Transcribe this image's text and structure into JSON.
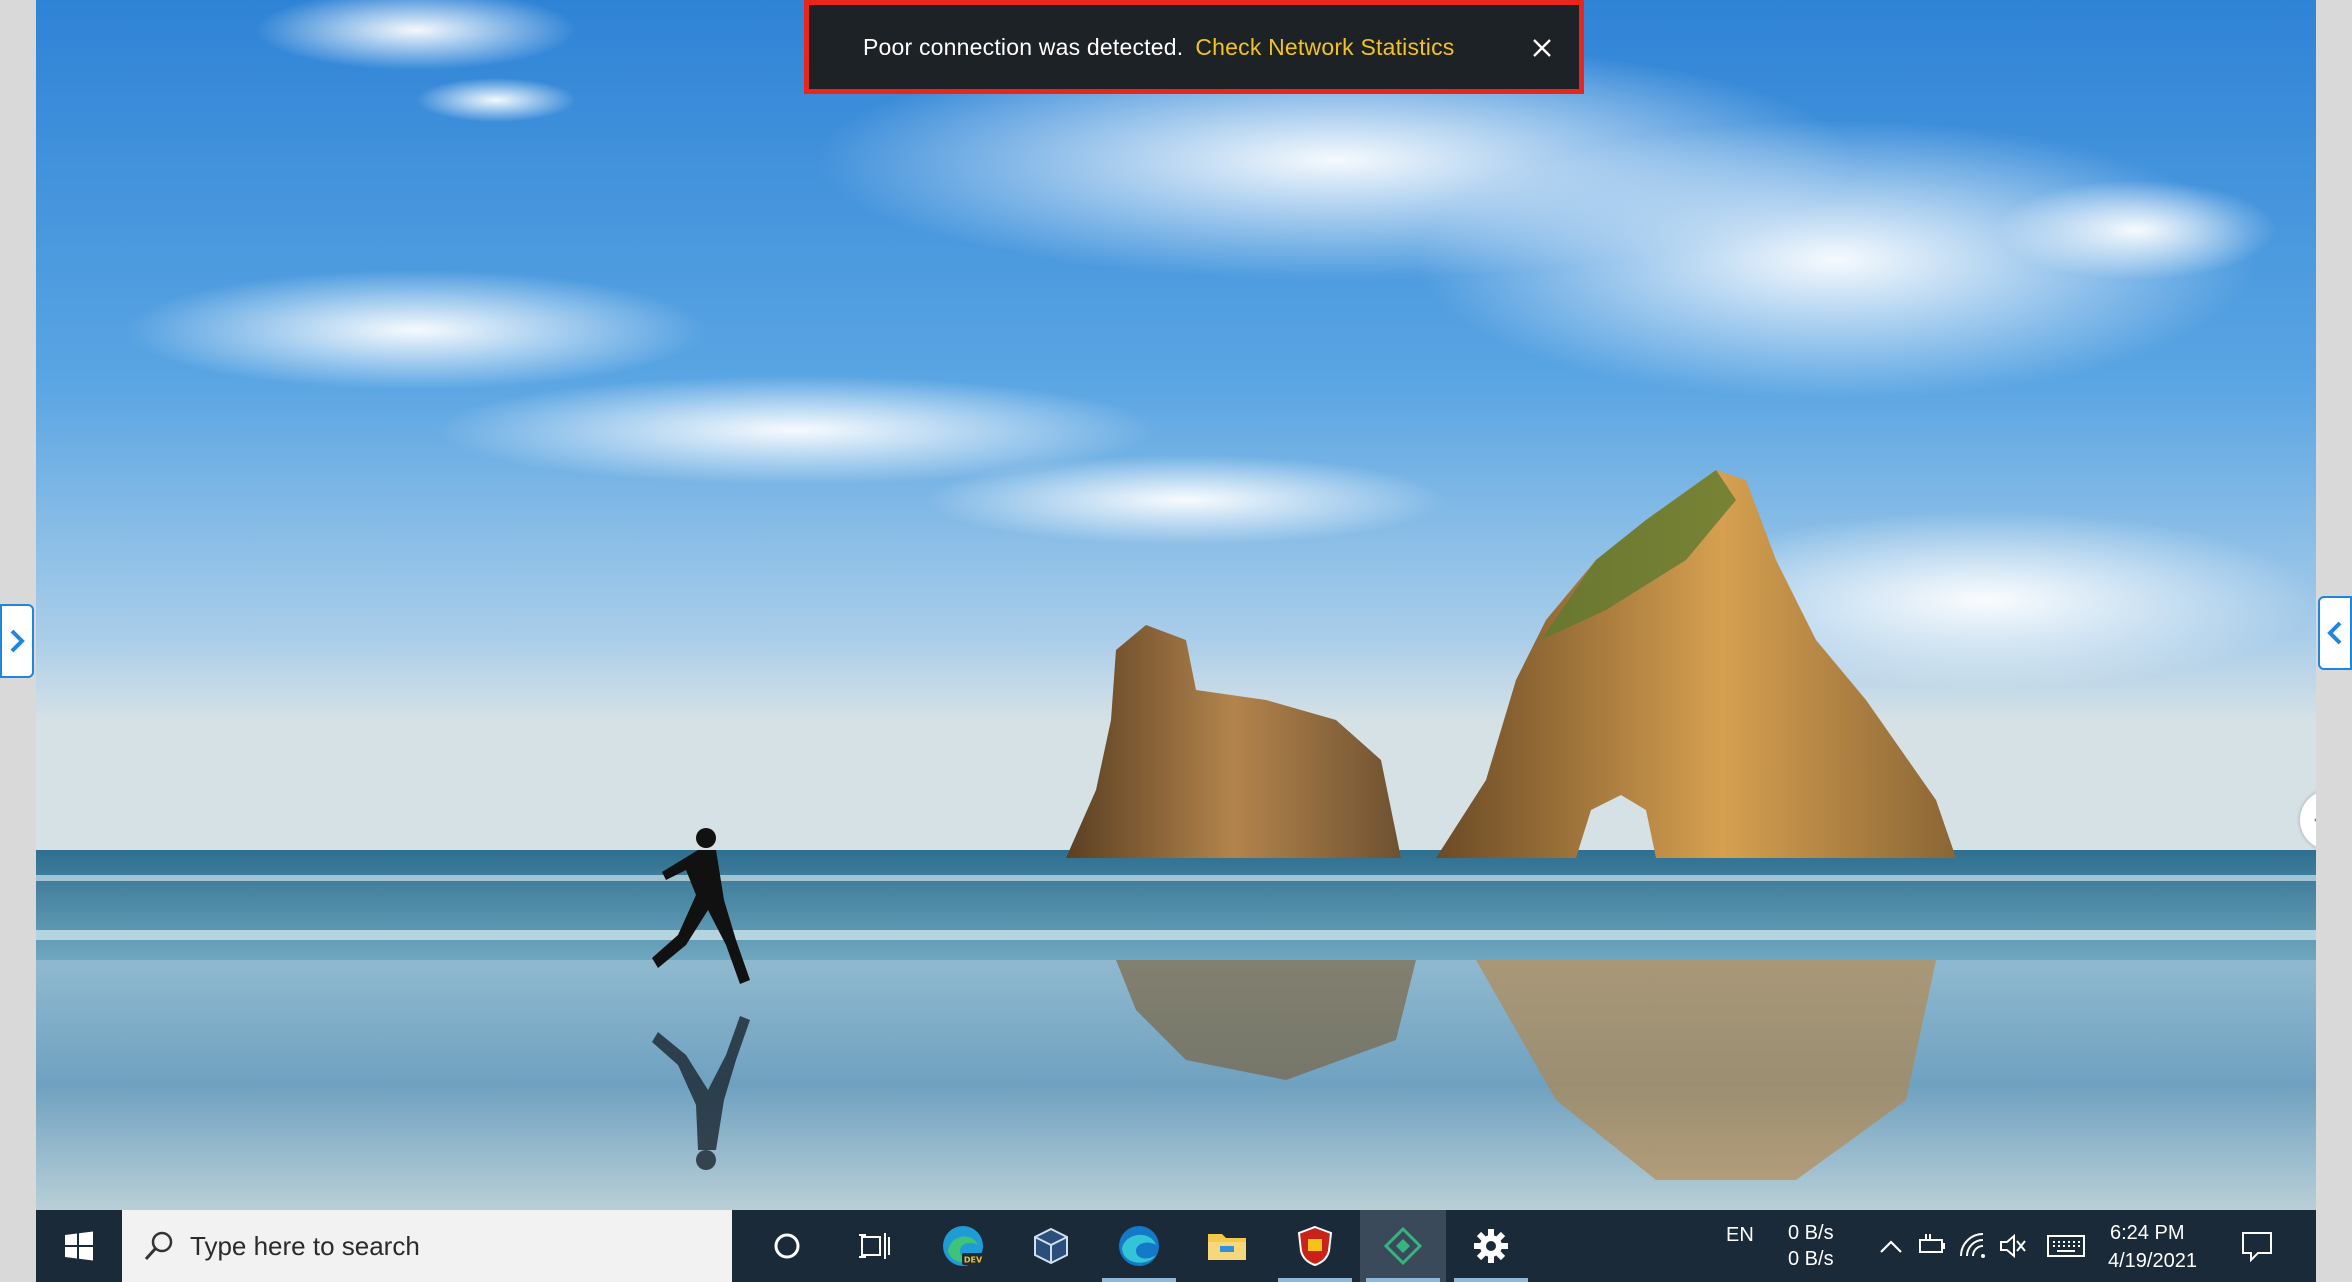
{
  "toast": {
    "message": "Poor connection was detected.",
    "link_label": "Check Network Statistics",
    "colors": {
      "background": "#1d2226",
      "border": "#e8261b",
      "link": "#f3c21b"
    },
    "close_icon": "close-icon"
  },
  "side_handles": {
    "left_icon": "chevron-right-icon",
    "right_icon": "chevron-left-icon",
    "floating_icon": "remote-app-diamond-icon"
  },
  "taskbar": {
    "start_icon": "windows-logo-icon",
    "search": {
      "icon": "search-icon",
      "placeholder": "Type here to search"
    },
    "pinned": [
      {
        "name": "cortana",
        "icon": "circle-icon"
      },
      {
        "name": "task-view",
        "icon": "task-view-icon"
      },
      {
        "name": "edge-dev",
        "icon": "edge-dev-icon",
        "badge": "DEV"
      },
      {
        "name": "virtualbox",
        "icon": "cube-icon"
      },
      {
        "name": "edge",
        "icon": "edge-icon"
      },
      {
        "name": "file-explorer",
        "icon": "folder-icon"
      },
      {
        "name": "security-app",
        "icon": "shield-icon"
      },
      {
        "name": "remote-desktop-app",
        "icon": "diamond-icon"
      },
      {
        "name": "settings",
        "icon": "gear-icon"
      }
    ],
    "tray": {
      "language": "EN",
      "net_up": "0 B/s",
      "net_down": "0 B/s",
      "time": "6:24 PM",
      "date": "4/19/2021",
      "icons": [
        "chevron-up-icon",
        "battery-icon",
        "wifi-icon",
        "volume-muted-icon",
        "keyboard-icon",
        "notification-icon"
      ]
    }
  }
}
